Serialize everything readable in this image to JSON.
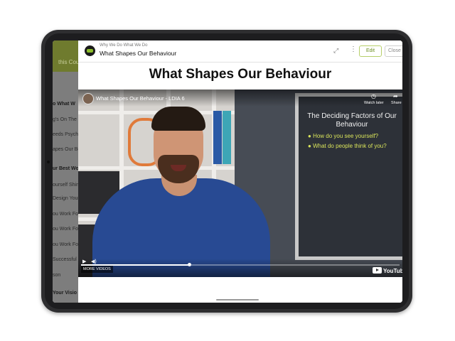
{
  "course_sidebar": {
    "header_text": "this Course",
    "items": [
      {
        "label": "o What W",
        "bold": true
      },
      {
        "label": "g's On The",
        "bold": false
      },
      {
        "label": "eeds Psych",
        "bold": false
      },
      {
        "label": "apes Our Be",
        "bold": false
      },
      {
        "label": "ur Best Wo",
        "bold": true
      },
      {
        "label": "ourself Shin",
        "bold": false
      },
      {
        "label": "Design Your",
        "bold": false
      },
      {
        "label": "ou Work For",
        "bold": false
      },
      {
        "label": "ou Work For",
        "bold": false
      },
      {
        "label": "ou Work For",
        "bold": false
      },
      {
        "label": "Successful E",
        "bold": false
      },
      {
        "label": "son",
        "bold": false
      },
      {
        "label": "Your Visio",
        "bold": true
      }
    ]
  },
  "modal": {
    "breadcrumb": "Why We Do What We Do",
    "title": "What Shapes Our Behaviour",
    "edit_label": "Edit",
    "close_label": "Close",
    "expand_icon": "expand-icon",
    "more_icon": "more-vertical-icon"
  },
  "content": {
    "heading": "What Shapes Our Behaviour"
  },
  "video": {
    "title": "What Shapes Our Behaviour - LDIA 6",
    "watch_later": "Watch later",
    "share": "Share",
    "more_videos": "MORE VIDEOS",
    "brand": "YouTube",
    "progress": 0.34,
    "board_title": "The Deciding Factors of Our Behaviour",
    "board_bullets": [
      "How do you see yourself?",
      "What do people think of you?"
    ]
  }
}
